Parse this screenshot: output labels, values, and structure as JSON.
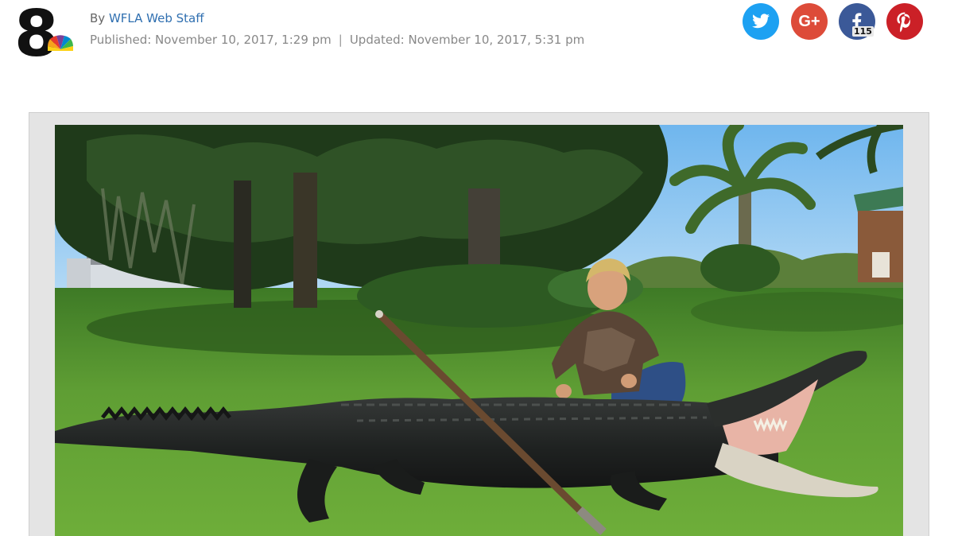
{
  "article": {
    "byline_prefix": "By",
    "author": "WFLA Web Staff",
    "published": "Published: November 10, 2017, 1:29 pm",
    "separator": "|",
    "updated": "Updated: November 10, 2017, 5:31 pm"
  },
  "logo": {
    "numeral": "8",
    "network": "NBC peacock"
  },
  "social": {
    "twitter_icon": "twitter-bird-icon",
    "googleplus_label": "G+",
    "facebook_icon": "facebook-f-icon",
    "facebook_count": "115",
    "pinterest_icon": "pinterest-p-icon"
  },
  "colors": {
    "twitter": "#1da1f2",
    "googleplus": "#dd4b39",
    "facebook": "#3b5998",
    "pinterest": "#cb2027",
    "author_link": "#2f6fb0"
  },
  "photo": {
    "subject": "boy kneeling behind a large alligator on grass, spear resting on it"
  }
}
